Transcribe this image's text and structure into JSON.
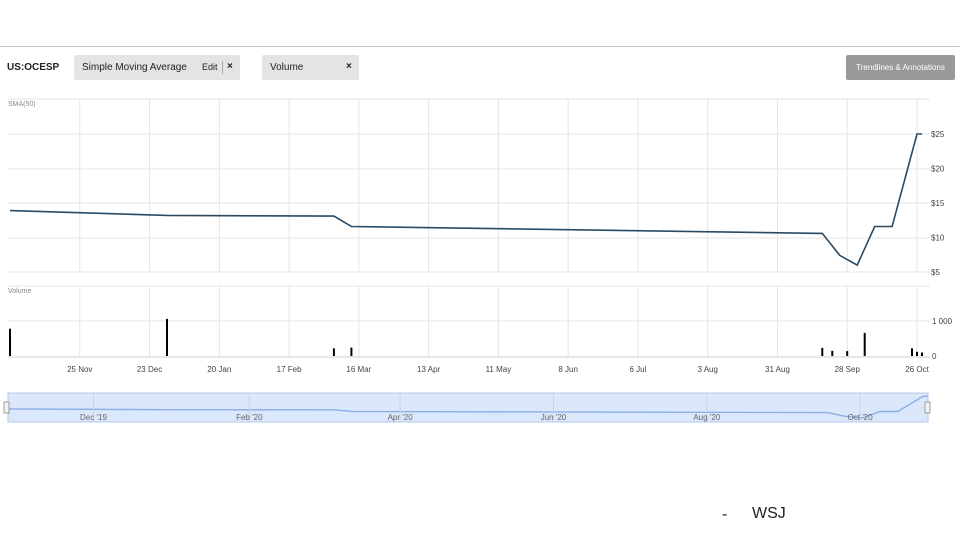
{
  "header": {
    "symbol": "US:OCESP",
    "sma_pill": {
      "label": "Simple Moving Average",
      "edit_label": "Edit",
      "close_glyph": "×"
    },
    "volume_pill": {
      "label": "Volume",
      "close_glyph": "×"
    },
    "trend_button_label": "Trendlines & Annotations"
  },
  "colors": {
    "line": "#2a4a63",
    "grid": "#e6e6e6",
    "volume": "#000000",
    "navigator_fill": "#dbe8fb",
    "navigator_line": "#8ab0e6"
  },
  "footer": {
    "dash": "-",
    "source": "WSJ"
  },
  "chart_data": [
    {
      "type": "line",
      "title": "SMA(50)",
      "x": [
        "2019-10-28",
        "2019-12-30",
        "2020-03-06",
        "2020-03-13",
        "2020-09-18",
        "2020-09-25",
        "2020-10-02",
        "2020-10-09",
        "2020-10-16",
        "2020-10-26",
        "2020-10-28"
      ],
      "series": [
        {
          "values": [
            13.9,
            13.2,
            13.1,
            11.6,
            10.6,
            7.4,
            6.0,
            11.6,
            11.6,
            25.0,
            25.0
          ]
        }
      ],
      "ylim": [
        5,
        27
      ],
      "yticks": [
        5,
        10,
        15,
        20,
        25
      ],
      "ytick_labels": [
        "$5",
        "$10",
        "$15",
        "$20",
        "$25"
      ],
      "grid": true
    },
    {
      "type": "bar",
      "title": "Volume",
      "x": [
        "2019-10-28",
        "2019-12-30",
        "2020-03-06",
        "2020-03-13",
        "2020-09-18",
        "2020-09-22",
        "2020-09-28",
        "2020-10-05",
        "2020-10-24",
        "2020-10-26",
        "2020-10-28"
      ],
      "values": [
        780,
        1060,
        220,
        240,
        230,
        150,
        140,
        660,
        220,
        120,
        100
      ],
      "ylim": [
        0,
        1500
      ],
      "yticks": [
        0,
        1000
      ],
      "ytick_labels": [
        "0",
        "1 000"
      ],
      "xtick_dates": [
        "2019-11-25",
        "2019-12-23",
        "2020-01-20",
        "2020-02-17",
        "2020-03-16",
        "2020-04-13",
        "2020-05-11",
        "2020-06-08",
        "2020-07-06",
        "2020-08-03",
        "2020-08-31",
        "2020-09-28",
        "2020-10-26"
      ],
      "xtick_labels": [
        "25 Nov",
        "23 Dec",
        "20 Jan",
        "17 Feb",
        "16 Mar",
        "13 Apr",
        "11 May",
        "8 Jun",
        "6 Jul",
        "3 Aug",
        "31 Aug",
        "28 Sep",
        "26 Oct"
      ],
      "grid": true
    },
    {
      "type": "area",
      "title": "",
      "x": [
        "2019-10-28",
        "2019-12-30",
        "2020-03-06",
        "2020-03-13",
        "2020-09-18",
        "2020-09-25",
        "2020-10-02",
        "2020-10-09",
        "2020-10-16",
        "2020-10-26",
        "2020-10-28"
      ],
      "values": [
        13.9,
        13.2,
        13.1,
        11.6,
        10.6,
        7.4,
        6.0,
        11.6,
        11.6,
        25.0,
        25.0
      ],
      "xtick_dates": [
        "2019-12-01",
        "2020-02-01",
        "2020-04-01",
        "2020-06-01",
        "2020-08-01",
        "2020-10-01"
      ],
      "xtick_labels": [
        "Dec '19",
        "Feb '20",
        "Apr '20",
        "Jun '20",
        "Aug '20",
        "Oct '20"
      ]
    }
  ]
}
